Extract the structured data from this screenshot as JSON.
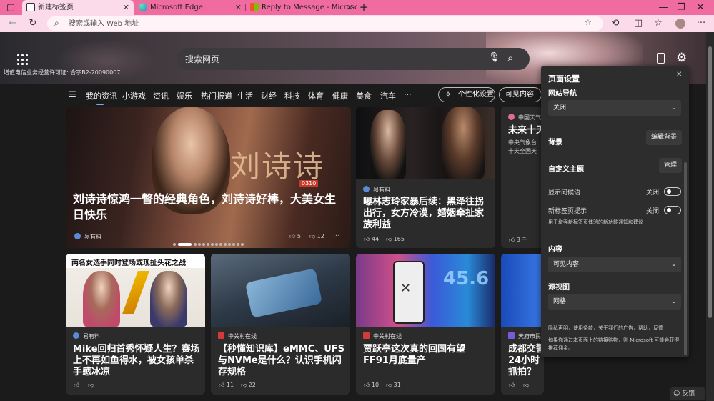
{
  "tabs": [
    {
      "label": "新建标签页",
      "active": true
    },
    {
      "label": "Microsoft Edge",
      "active": false
    },
    {
      "label": "Reply to Message - Microsoft Co",
      "active": false
    }
  ],
  "toolbar": {
    "address_placeholder": "搜索或输入 Web 地址"
  },
  "hero": {
    "search_placeholder": "搜索网页",
    "icp_text": "增值电信业务经营许可证: 合字B2-20090007"
  },
  "nav": {
    "items": [
      "我的资讯",
      "小游戏",
      "资讯",
      "娱乐",
      "热门报道",
      "生活",
      "财经",
      "科技",
      "体育",
      "健康",
      "美食",
      "汽车",
      "···"
    ],
    "personalize": "个性化设置",
    "visible_content": "可见内容"
  },
  "cards": {
    "c1": {
      "title": "刘诗诗惊鸿一瞥的经典角色，刘诗诗好棒，大美女生日快乐",
      "source": "易有料",
      "likes": "5",
      "dislikes": "12",
      "more": "···",
      "img_text": "刘诗诗",
      "img_text2": "0310",
      "img_text3": "生日快乐"
    },
    "c2": {
      "title": "曝林志玲家暴后续：黑泽往拐出行，女方冷漠，婚姻牵扯家族利益",
      "source": "易有料",
      "likes": "44",
      "dislikes": "165"
    },
    "c3": {
      "title": "未来十天",
      "sub": "中央气象台\n十天全国天",
      "source": "中国天气",
      "likes": "3 千"
    },
    "c4": {
      "title": "Mike回归首秀怀疑人生？赛场上不再如鱼得水，被女孩单杀手感冰凉",
      "source": "易有料",
      "img_text": "两名女选手同时登场或现扯头花之战"
    },
    "c5": {
      "title": "【秒懂知识库】eMMC、UFS与NVMe是什么？认识手机闪存规格",
      "source": "中关村在线",
      "likes": "11",
      "dislikes": "22"
    },
    "c6": {
      "title": "贾跃亭这次真的回国有望 FF91月底量产",
      "source": "中关村在线",
      "likes": "10",
      "dislikes": "31",
      "img_text": "45.6"
    },
    "c7": {
      "title": "成都交警24小时抓拍？",
      "source": "天府市民"
    }
  },
  "panel": {
    "title": "页面设置",
    "site_nav": "网站导航",
    "site_nav_value": "关闭",
    "background": "背景",
    "edit_background": "编辑背景",
    "custom_theme": "自定义主题",
    "manage": "管理",
    "show_greeting": "显示问候语",
    "show_greeting_state": "关闭",
    "tips": "新标签页提示",
    "tips_state": "关闭",
    "tips_desc": "用于增强新标签页体验的新功能通知和建议",
    "content": "内容",
    "content_value": "可见内容",
    "source_view": "源视图",
    "source_view_value": "网格",
    "footer_links": "隐私声明，使用条款，关于我们的广告，帮助，反馈",
    "footer_note": "如果你通过本页面上的链接购物，则 Microsoft 可能会获得推荐佣金。"
  },
  "feedback": "反馈"
}
